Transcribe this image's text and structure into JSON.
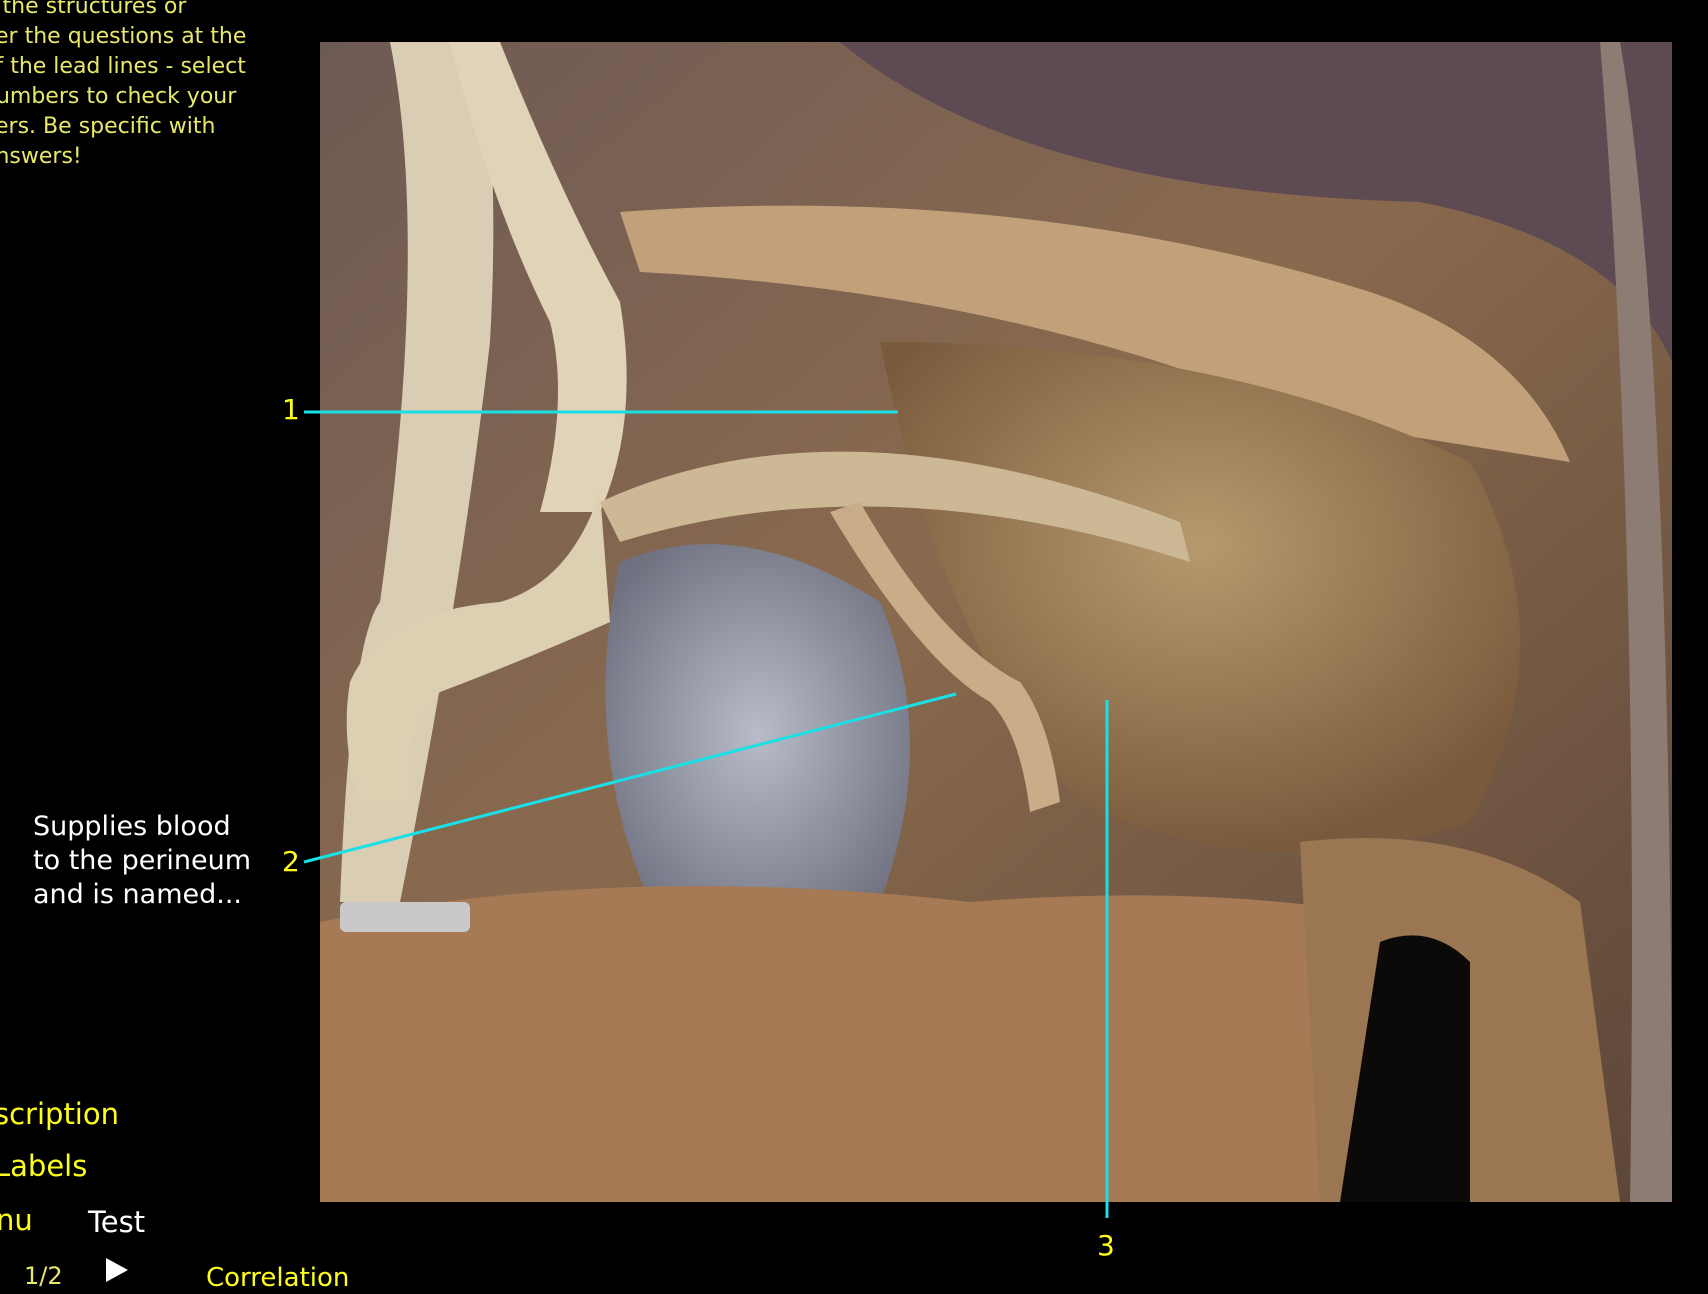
{
  "instructions": "e the structures or\nver the questions at the\nof the lead lines - select\nnumbers to check your\nvers. Be specific with\nanswers!",
  "labels": [
    "1",
    "2",
    "3"
  ],
  "question": "Supplies blood\nto the perineum\nand is named...",
  "menu": {
    "description": "scription",
    "labels": "Labels",
    "menu": "nu",
    "test": "Test",
    "pager": "1/2",
    "correlation": "Correlation"
  },
  "colors": {
    "leader": "#19e0e6",
    "number": "#ffff1a",
    "accent": "#e8e86a"
  }
}
